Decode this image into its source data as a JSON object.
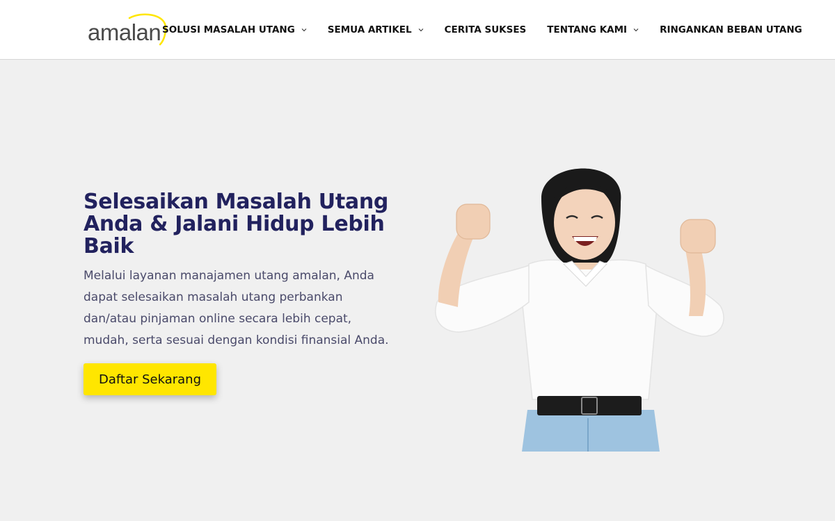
{
  "logo": {
    "text": "amalan",
    "accent_color": "#ffe600",
    "text_color": "#4a4a4a"
  },
  "nav": {
    "items": [
      {
        "label": "SOLUSI MASALAH UTANG",
        "has_dropdown": true
      },
      {
        "label": "SEMUA ARTIKEL",
        "has_dropdown": true
      },
      {
        "label": "CERITA SUKSES",
        "has_dropdown": false
      },
      {
        "label": "TENTANG KAMI",
        "has_dropdown": true
      },
      {
        "label": "RINGANKAN BEBAN UTANG",
        "has_dropdown": false
      }
    ]
  },
  "hero": {
    "title": "Selesaikan Masalah Utang Anda & Jalani Hidup Lebih Baik",
    "description": "Melalui layanan manajamen utang amalan, Anda dapat selesaikan masalah utang perbankan dan/atau pinjaman online secara lebih cepat, mudah, serta sesuai dengan kondisi finansial Anda.",
    "cta_label": "Daftar Sekarang",
    "image_icon": "woman-celebrating-illustration"
  },
  "colors": {
    "title": "#22225e",
    "background": "#f0f0f0",
    "cta": "#ffe600",
    "header": "#ffffff"
  }
}
